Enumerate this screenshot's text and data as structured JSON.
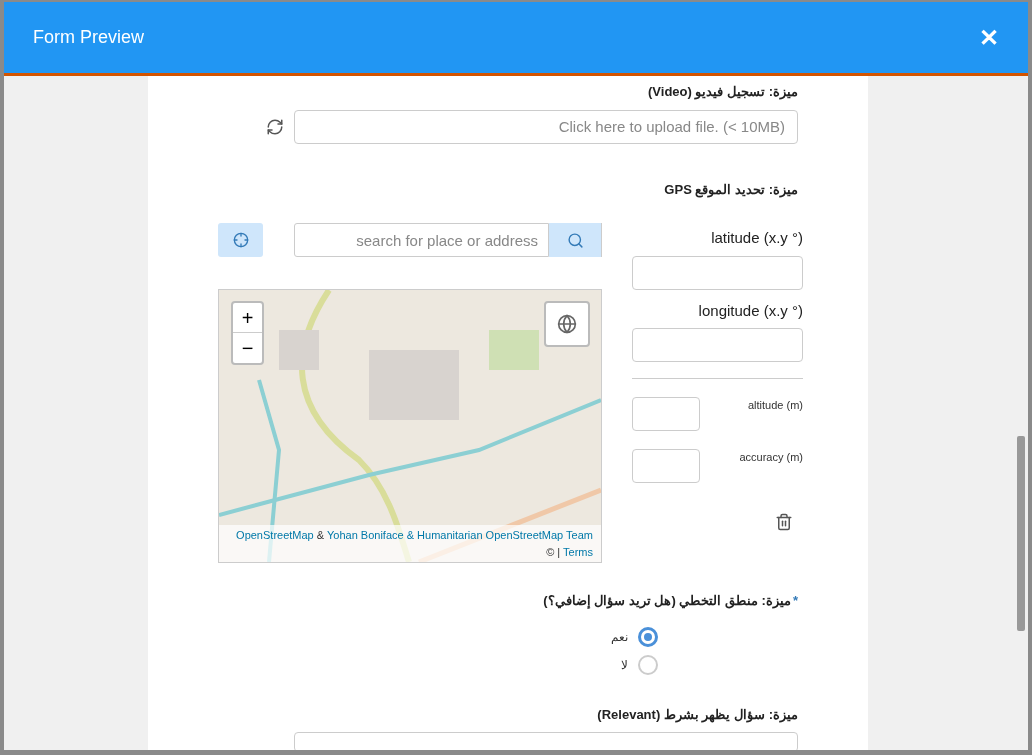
{
  "window": {
    "title": "Form Preview",
    "close": "✕"
  },
  "video": {
    "label": "ميزة: تسجيل فيديو (Video)",
    "placeholder": "Click here to upload file. (< 10MB)"
  },
  "gps": {
    "label": "ميزة: تحديد الموقع GPS",
    "search_placeholder": "search for place or address",
    "zoom_in": "+",
    "zoom_out": "−",
    "attribution": {
      "map_link": "OpenStreetMap",
      "joiner": "&",
      "team_link": "Yohan Boniface & Humanitarian OpenStreetMap Team",
      "copyright": "©",
      "separator": "|",
      "terms_link": "Terms"
    },
    "fields": [
      {
        "label": "latitude (x.y °)",
        "kind": "wide"
      },
      {
        "label": "longitude (x.y °)",
        "kind": "wide"
      },
      {
        "label": "altitude (m)",
        "kind": "small"
      },
      {
        "label": "accuracy (m)",
        "kind": "small"
      }
    ]
  },
  "choice": {
    "required": true,
    "required_mark": "*",
    "label": "ميزة: منطق التخطي (هل تريد سؤال إضافي؟)",
    "options": [
      {
        "label": "نعم",
        "selected": true
      },
      {
        "label": "لا",
        "selected": false
      }
    ]
  },
  "relevant": {
    "label": "ميزة: سؤال يظهر بشرط (Relevant)"
  }
}
